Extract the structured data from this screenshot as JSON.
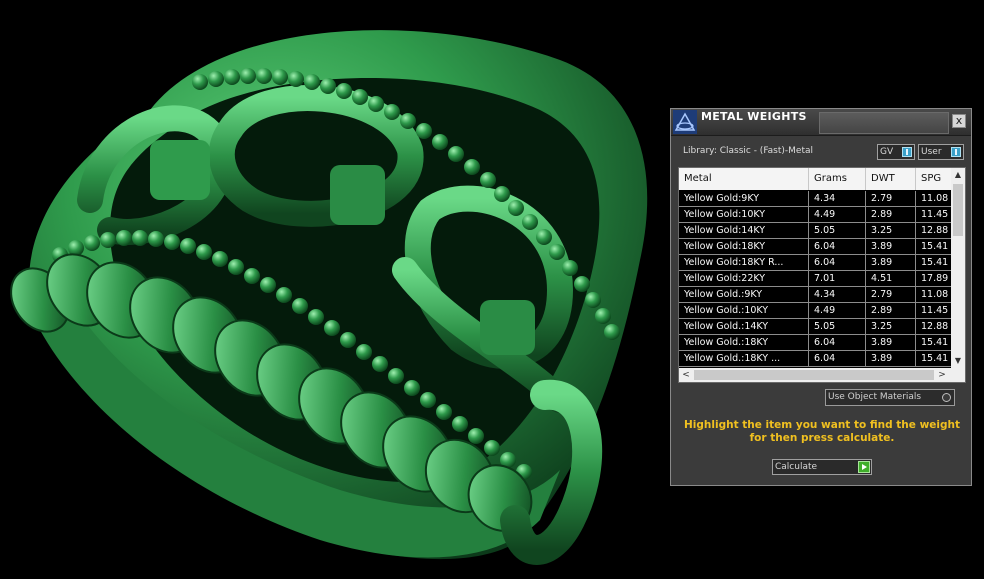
{
  "panel": {
    "title": "METAL WEIGHTS",
    "close_glyph": "x",
    "library_label": "Library: Classic - (Fast)-Metal",
    "toggle_gv": "GV",
    "toggle_user": "User",
    "table": {
      "headers": [
        "Metal",
        "Grams",
        "DWT",
        "SPG"
      ],
      "rows": [
        [
          "Yellow Gold:9KY",
          "4.34",
          "2.79",
          "11.08"
        ],
        [
          "Yellow Gold:10KY",
          "4.49",
          "2.89",
          "11.45"
        ],
        [
          "Yellow Gold:14KY",
          "5.05",
          "3.25",
          "12.88"
        ],
        [
          "Yellow Gold:18KY",
          "6.04",
          "3.89",
          "15.41"
        ],
        [
          "Yellow Gold:18KY R...",
          "6.04",
          "3.89",
          "15.41"
        ],
        [
          "Yellow Gold:22KY",
          "7.01",
          "4.51",
          "17.89"
        ],
        [
          "Yellow Gold.:9KY",
          "4.34",
          "2.79",
          "11.08"
        ],
        [
          "Yellow Gold.:10KY",
          "4.49",
          "2.89",
          "11.45"
        ],
        [
          "Yellow Gold.:14KY",
          "5.05",
          "3.25",
          "12.88"
        ],
        [
          "Yellow Gold.:18KY",
          "6.04",
          "3.89",
          "15.41"
        ],
        [
          "Yellow Gold.:18KY ...",
          "6.04",
          "3.89",
          "15.41"
        ]
      ]
    },
    "use_object_materials": "Use Object Materials",
    "hint": "Highlight the item you want to find the weight for then press calculate.",
    "calculate_label": "Calculate"
  },
  "icons": {
    "title_logo": "matrix-logo-icon",
    "close": "close-icon",
    "scroll_up": "chevron-up-icon",
    "scroll_down": "chevron-down-icon",
    "scroll_left": "chevron-left-icon",
    "scroll_right": "chevron-right-icon",
    "calculate": "play-icon"
  },
  "colors": {
    "viewport_bg": "#000000",
    "model_green": "#2f9b4c",
    "hint_text": "#f0c020",
    "panel_bg": "#3b3b3b"
  }
}
